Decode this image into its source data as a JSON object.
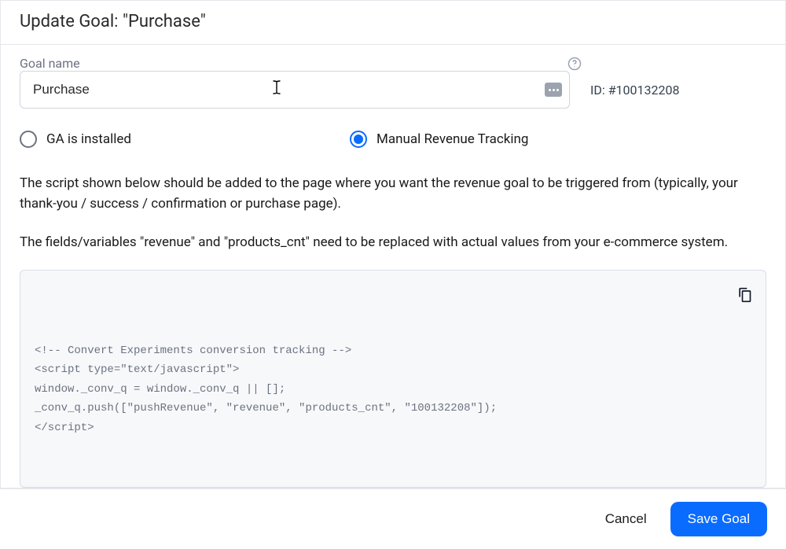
{
  "header": {
    "title": "Update Goal: \"Purchase\""
  },
  "form": {
    "goal_name_label": "Goal name",
    "goal_name_value": "Purchase",
    "id_label": "ID: #100132208"
  },
  "tracking_options": {
    "ga": {
      "label": "GA is installed",
      "selected": false
    },
    "manual": {
      "label": "Manual Revenue Tracking",
      "selected": true
    }
  },
  "instructions": {
    "p1": "The script shown below should be added to the page where you want the revenue goal to be triggered from (typically, your thank-you / success / confirmation or purchase page).",
    "p2": "The fields/variables \"revenue\" and \"products_cnt\" need to be replaced with actual values from your e-commerce system."
  },
  "code_snippet": "<!-- Convert Experiments conversion tracking -->\n<script type=\"text/javascript\">\nwindow._conv_q = window._conv_q || [];\n_conv_q.push([\"pushRevenue\", \"revenue\", \"products_cnt\", \"100132208\"]);\n</script>",
  "footer": {
    "cancel": "Cancel",
    "save": "Save Goal"
  },
  "colors": {
    "primary": "#0a6cff",
    "border": "#e5e7eb",
    "muted": "#6b7280",
    "code_bg": "#f7f8fa"
  }
}
